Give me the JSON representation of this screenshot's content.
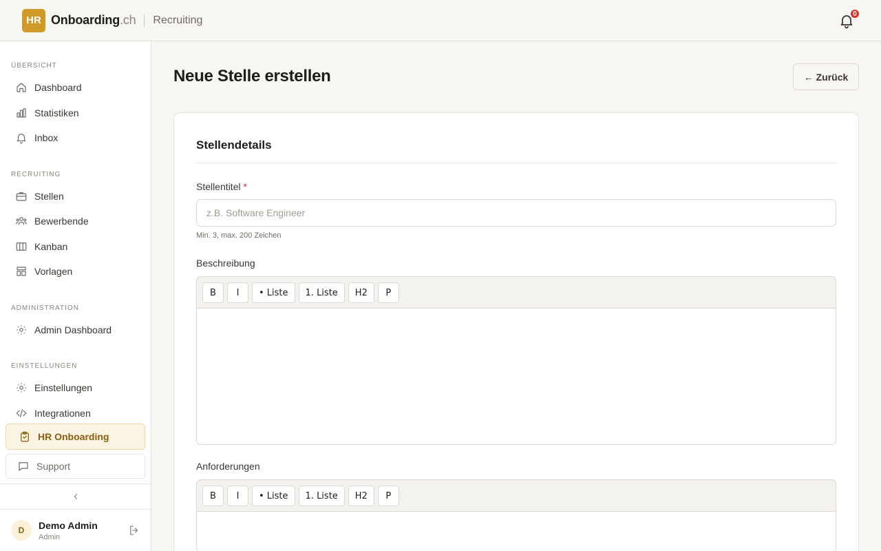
{
  "header": {
    "logo_text": "HR",
    "brand_name": "Onboarding",
    "brand_tld": ".ch",
    "section": "Recruiting",
    "notification_count": "0"
  },
  "sidebar": {
    "sections": [
      {
        "label": "ÜBERSICHT",
        "items": [
          "Dashboard",
          "Statistiken",
          "Inbox"
        ]
      },
      {
        "label": "RECRUITING",
        "items": [
          "Stellen",
          "Bewerbende",
          "Kanban",
          "Vorlagen"
        ]
      },
      {
        "label": "ADMINISTRATION",
        "items": [
          "Admin Dashboard"
        ]
      },
      {
        "label": "EINSTELLUNGEN",
        "items": [
          "Einstellungen",
          "Integrationen"
        ]
      }
    ],
    "active_item": "HR Onboarding",
    "support_item": "Support"
  },
  "user": {
    "initial": "D",
    "name": "Demo Admin",
    "role": "Admin"
  },
  "page": {
    "title": "Neue Stelle erstellen",
    "back_label": "← Zurück"
  },
  "form": {
    "card_title": "Stellendetails",
    "title_label": "Stellentitel",
    "required_mark": "*",
    "title_placeholder": "z.B. Software Engineer",
    "title_value": "",
    "title_hint": "Min. 3, max. 200 Zeichen",
    "description_label": "Beschreibung",
    "requirements_label": "Anforderungen",
    "toolbar_buttons": [
      "B",
      "I",
      "• Liste",
      "1. Liste",
      "H2",
      "P"
    ]
  },
  "colors": {
    "accent": "#d09a28",
    "active_bg": "#fbf4e3",
    "badge": "#d9342b",
    "background": "#f7f6f3"
  }
}
